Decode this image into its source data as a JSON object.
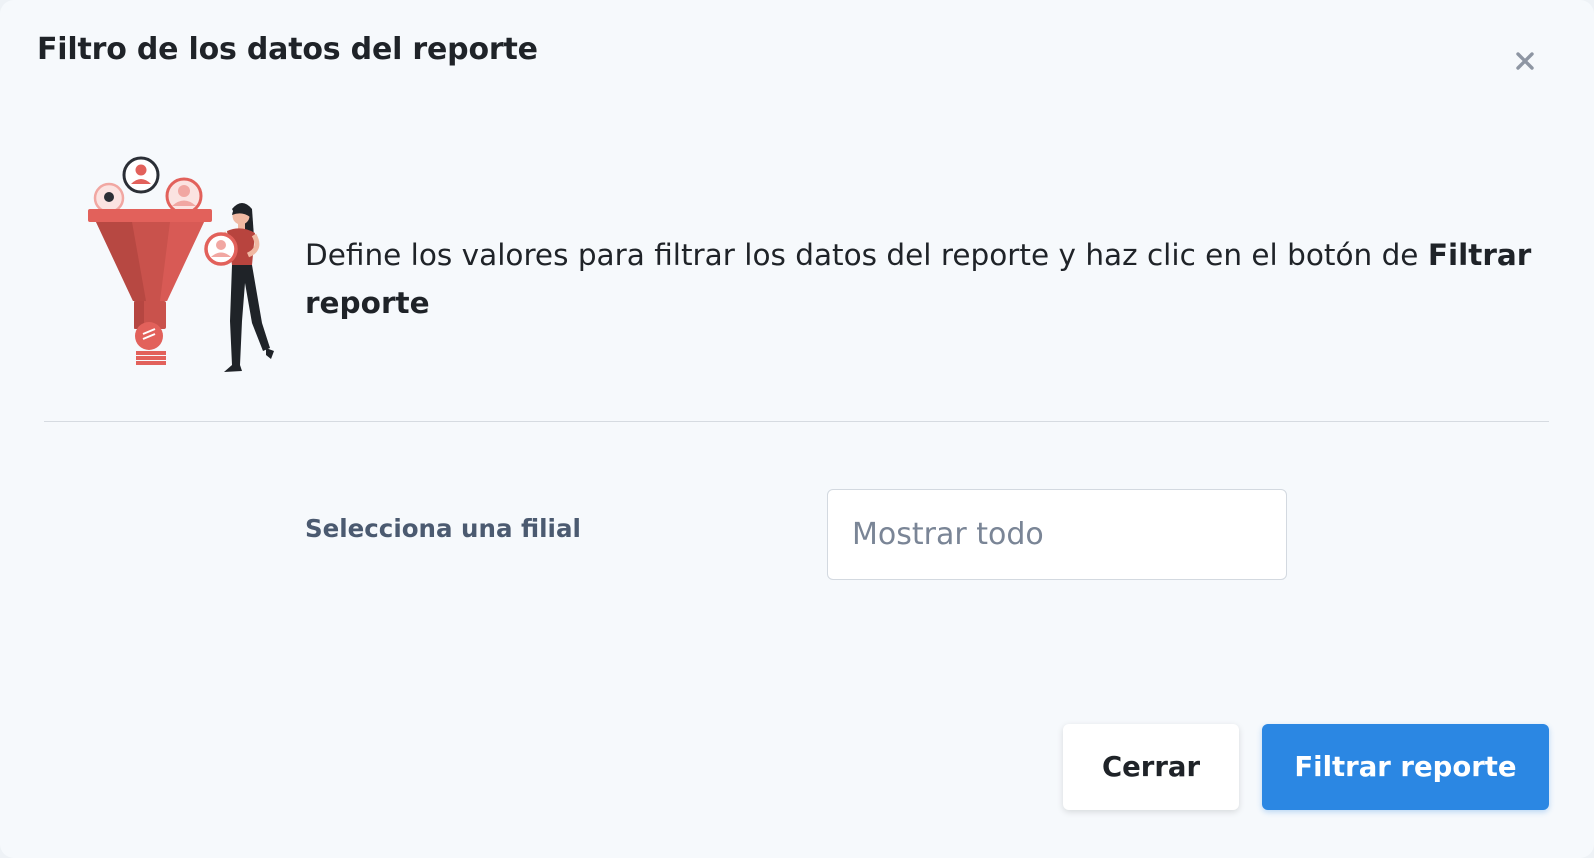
{
  "modal": {
    "title": "Filtro de los datos del reporte",
    "close_icon": "close-icon",
    "close_symbol": "×"
  },
  "intro": {
    "text_before": " Define los valores para filtrar los datos del reporte y haz clic en el botón de ",
    "text_bold": "Filtrar reporte",
    "illustration_icon": "funnel-filter-illustration"
  },
  "filter": {
    "label": "Selecciona una filial",
    "select_value": "Mostrar todo"
  },
  "footer": {
    "cancel_label": "Cerrar",
    "submit_label": "Filtrar reporte"
  },
  "colors": {
    "primary": "#2b87e3",
    "background": "#f6f9fc",
    "illustration_red": "#e2615b",
    "label": "#4b5a70",
    "placeholder": "#7a8596"
  }
}
